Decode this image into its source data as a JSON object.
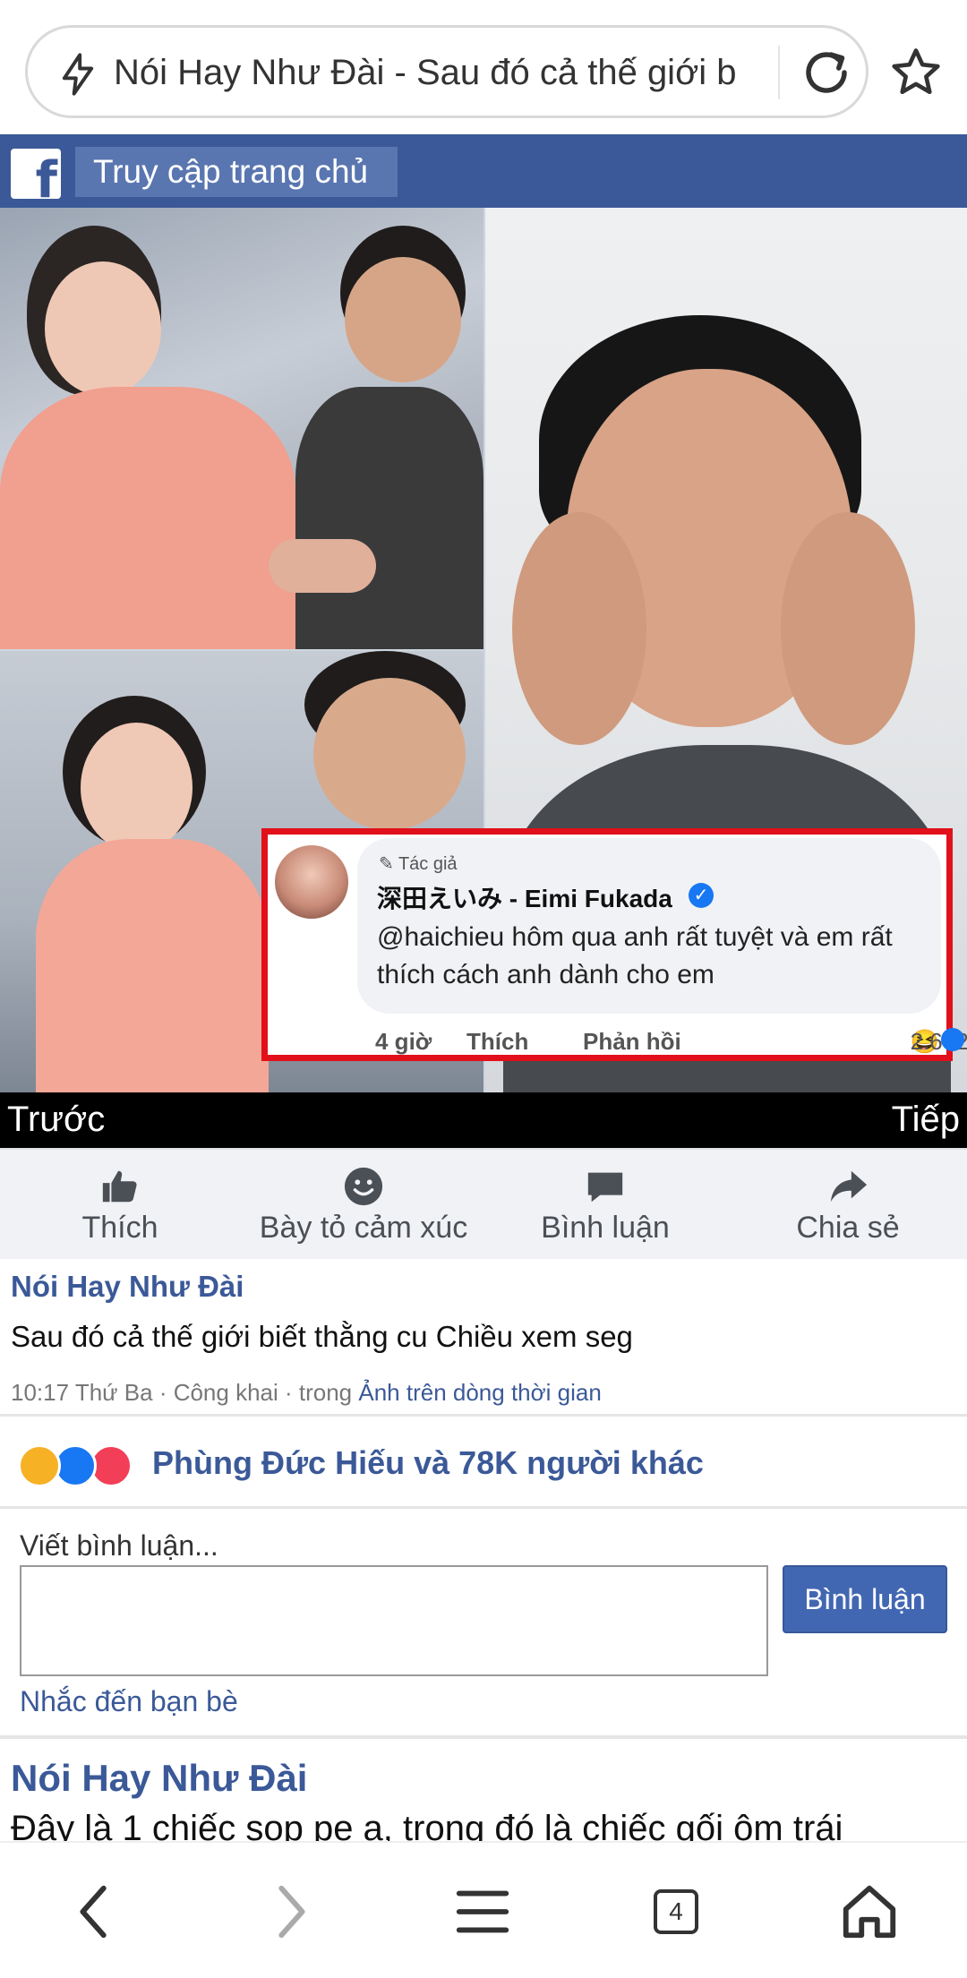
{
  "browser": {
    "title": "Nói Hay Như Đài - Sau đó cả thế giới b",
    "icons": {
      "flash": "flash-icon",
      "reload": "reload-icon",
      "bookmark": "star-icon"
    }
  },
  "fb_header": {
    "logo": "f",
    "home_link": "Truy cập trang chủ"
  },
  "photo": {
    "comment": {
      "role": "Tác giả",
      "name": "深田えいみ - Eimi Fukada",
      "verified": "✓",
      "text": "@haichieu hôm qua anh rất tuyệt và em rất thích cách anh dành cho em",
      "time": "4 giờ",
      "like": "Thích",
      "reply": "Phản hồi",
      "reactions": "2.672"
    },
    "prev": "Trước",
    "next": "Tiếp"
  },
  "actions": [
    {
      "label": "Thích",
      "icon": "like-icon"
    },
    {
      "label": "Bày tỏ cảm xúc",
      "icon": "emoji-icon"
    },
    {
      "label": "Bình luận",
      "icon": "comment-icon"
    },
    {
      "label": "Chia sẻ",
      "icon": "share-icon"
    }
  ],
  "post": {
    "author": "Nói Hay Như Đài",
    "text": "Sau đó cả thế giới biết thằng cu Chiều xem seg",
    "meta_prefix": "10:17 Thứ Ba · Công khai · trong ",
    "meta_link": "Ảnh trên dòng thời gian"
  },
  "reactions_summary": {
    "text": "Phùng Đức Hiếu và 78K người khác",
    "colors": {
      "haha": "#f7b125",
      "like": "#1877f2",
      "love": "#f33e58"
    }
  },
  "comment_form": {
    "label": "Viết bình luận...",
    "value": "",
    "submit": "Bình luận",
    "mention": "Nhắc đến bạn bè"
  },
  "next_post": {
    "author": "Nói Hay Như Đài",
    "text": "Đây là 1 chiếc sop pe a, trong đó là chiếc gối ôm trái"
  },
  "bottom_nav": {
    "tabs_count": "4",
    "icons": [
      "back-icon",
      "forward-icon",
      "menu-icon",
      "tabs-icon",
      "home-icon"
    ]
  },
  "theme": {
    "facebook_blue": "#3b5998",
    "highlight_red": "#e1101a"
  }
}
